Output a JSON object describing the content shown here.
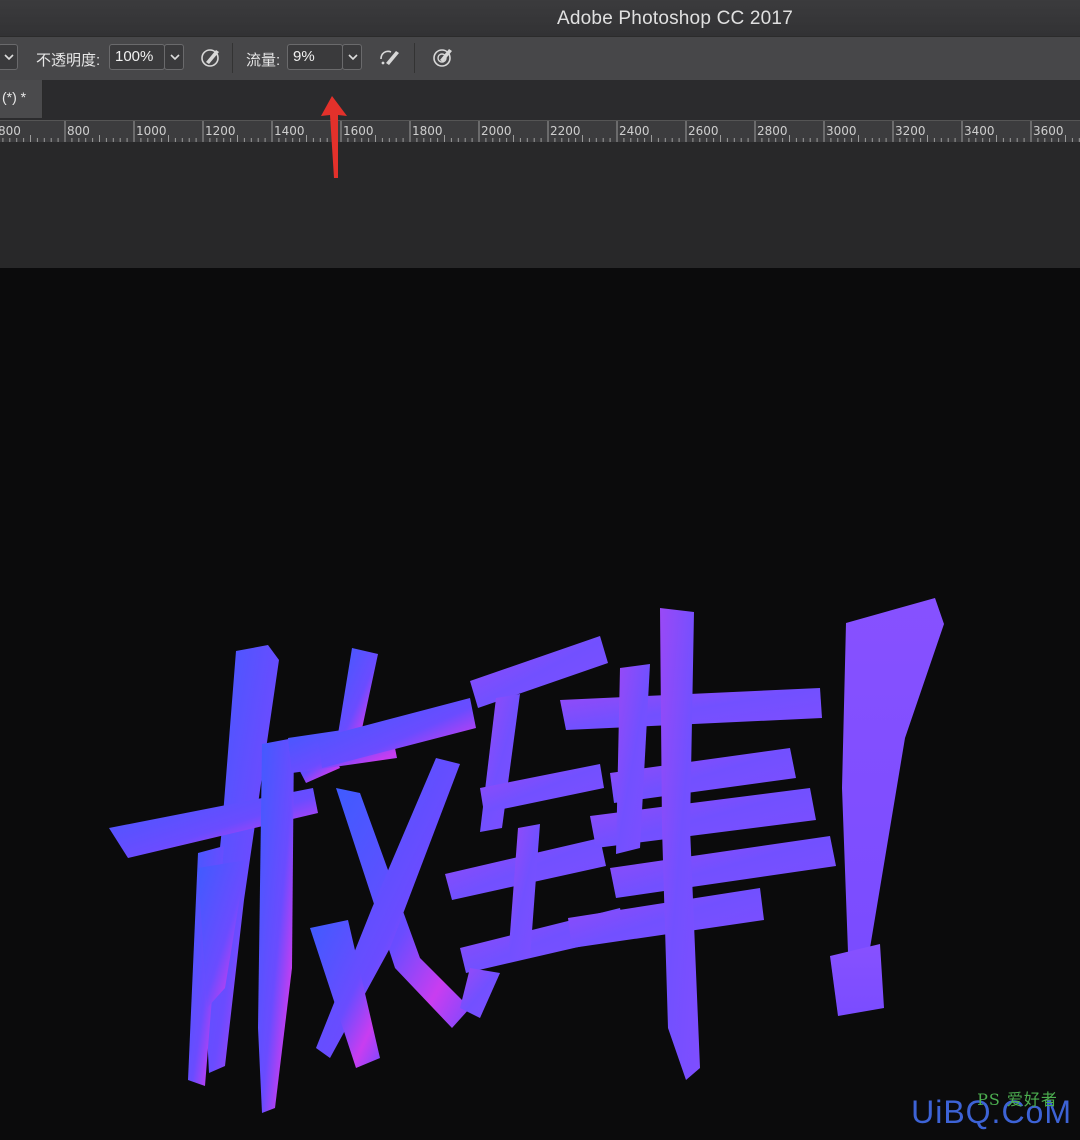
{
  "window": {
    "title": "Adobe Photoshop CC 2017"
  },
  "options_bar": {
    "opacity_label": "不透明度:",
    "opacity_value": "100%",
    "flow_label": "流量:",
    "flow_value": "9%"
  },
  "document_tab": {
    "label": "(*) *"
  },
  "ruler": {
    "labels": [
      "800",
      "800",
      "1000",
      "1200",
      "1400",
      "1600",
      "1800",
      "2000",
      "2200",
      "2400",
      "2600",
      "2800",
      "3000",
      "3200",
      "3400",
      "3600"
    ]
  },
  "canvas": {
    "artwork_text": "放肆!",
    "gradient_colors": [
      "#3f5bff",
      "#7a4bff",
      "#c93df0",
      "#8a55ff"
    ]
  },
  "annotation": {
    "arrow_color": "#e3312b"
  },
  "watermark": {
    "text": "UiBQ.CoM",
    "small_text": "PS 爱好者"
  },
  "icons": {
    "brush_pressure_opacity": "pen-pressure-icon",
    "airbrush": "airbrush-icon",
    "brush_pressure_size": "pen-pressure-size-icon",
    "dropdown": "chevron-down-icon"
  }
}
